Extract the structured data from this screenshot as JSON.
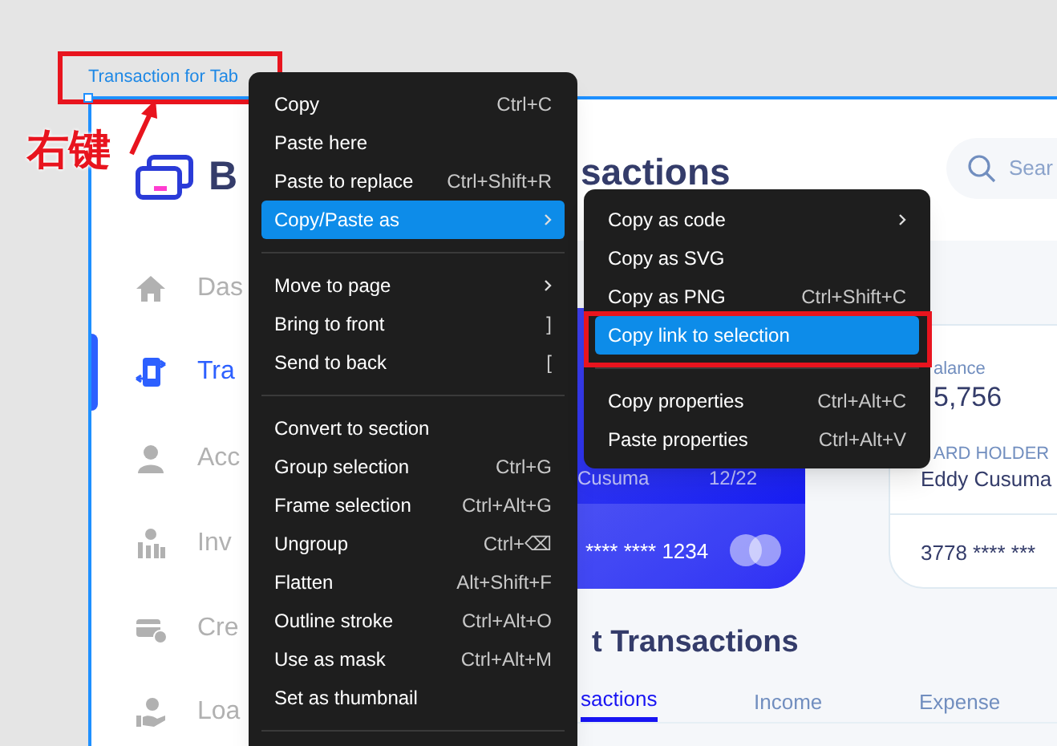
{
  "canvas": {
    "frame_label": "Transaction for Tab",
    "annotation_text": "右键"
  },
  "design": {
    "logo_text": "B",
    "title": "sactions",
    "search": {
      "placeholder": "Sear"
    },
    "sidebar": [
      {
        "label": "Das",
        "kind": "home",
        "selected": false
      },
      {
        "label": "Tra",
        "kind": "transfer",
        "selected": true
      },
      {
        "label": "Acc",
        "kind": "user",
        "selected": false
      },
      {
        "label": "Inv",
        "kind": "invest",
        "selected": false
      },
      {
        "label": "Cre",
        "kind": "credit",
        "selected": false
      },
      {
        "label": "Loa",
        "kind": "loan",
        "selected": false
      }
    ],
    "card": {
      "holder": "Cusuma",
      "expiry": "12/22",
      "number": "**** **** 1234"
    },
    "account_card": {
      "balance_label": "alance",
      "balance": "5,756",
      "holder_label": "ARD HOLDER",
      "holder": "Eddy Cusuma",
      "number": "3778 **** ***"
    },
    "section_title": "t Transactions",
    "tabs": [
      {
        "label": "sactions",
        "selected": true
      },
      {
        "label": "Income",
        "selected": false
      },
      {
        "label": "Expense",
        "selected": false
      }
    ]
  },
  "context_menu": {
    "groups": [
      [
        {
          "label": "Copy",
          "shortcut": "Ctrl+C",
          "has_submenu": false,
          "selected": false
        },
        {
          "label": "Paste here",
          "has_submenu": false,
          "selected": false
        },
        {
          "label": "Paste to replace",
          "shortcut": "Ctrl+Shift+R",
          "has_submenu": false,
          "selected": false
        },
        {
          "label": "Copy/Paste as",
          "has_submenu": true,
          "selected": true
        }
      ],
      [
        {
          "label": "Move to page",
          "has_submenu": true,
          "selected": false
        },
        {
          "label": "Bring to front",
          "shortcut": "]",
          "has_submenu": false,
          "selected": false
        },
        {
          "label": "Send to back",
          "shortcut": "[",
          "has_submenu": false,
          "selected": false
        }
      ],
      [
        {
          "label": "Convert to section",
          "has_submenu": false,
          "selected": false
        },
        {
          "label": "Group selection",
          "shortcut": "Ctrl+G",
          "has_submenu": false,
          "selected": false
        },
        {
          "label": "Frame selection",
          "shortcut": "Ctrl+Alt+G",
          "has_submenu": false,
          "selected": false
        },
        {
          "label": "Ungroup",
          "shortcut": "Ctrl+⌫",
          "has_submenu": false,
          "selected": false
        },
        {
          "label": "Flatten",
          "shortcut": "Alt+Shift+F",
          "has_submenu": false,
          "selected": false
        },
        {
          "label": "Outline stroke",
          "shortcut": "Ctrl+Alt+O",
          "has_submenu": false,
          "selected": false
        },
        {
          "label": "Use as mask",
          "shortcut": "Ctrl+Alt+M",
          "has_submenu": false,
          "selected": false
        },
        {
          "label": "Set as thumbnail",
          "has_submenu": false,
          "selected": false
        }
      ]
    ]
  },
  "submenu": {
    "groups": [
      [
        {
          "label": "Copy as code",
          "has_submenu": true,
          "selected": false
        },
        {
          "label": "Copy as SVG",
          "has_submenu": false,
          "selected": false
        },
        {
          "label": "Copy as PNG",
          "shortcut": "Ctrl+Shift+C",
          "has_submenu": false,
          "selected": false
        },
        {
          "label": "Copy link to selection",
          "has_submenu": false,
          "selected": true
        }
      ],
      [
        {
          "label": "Copy properties",
          "shortcut": "Ctrl+Alt+C",
          "has_submenu": false,
          "selected": false
        },
        {
          "label": "Paste properties",
          "shortcut": "Ctrl+Alt+V",
          "has_submenu": false,
          "selected": false
        }
      ]
    ]
  }
}
